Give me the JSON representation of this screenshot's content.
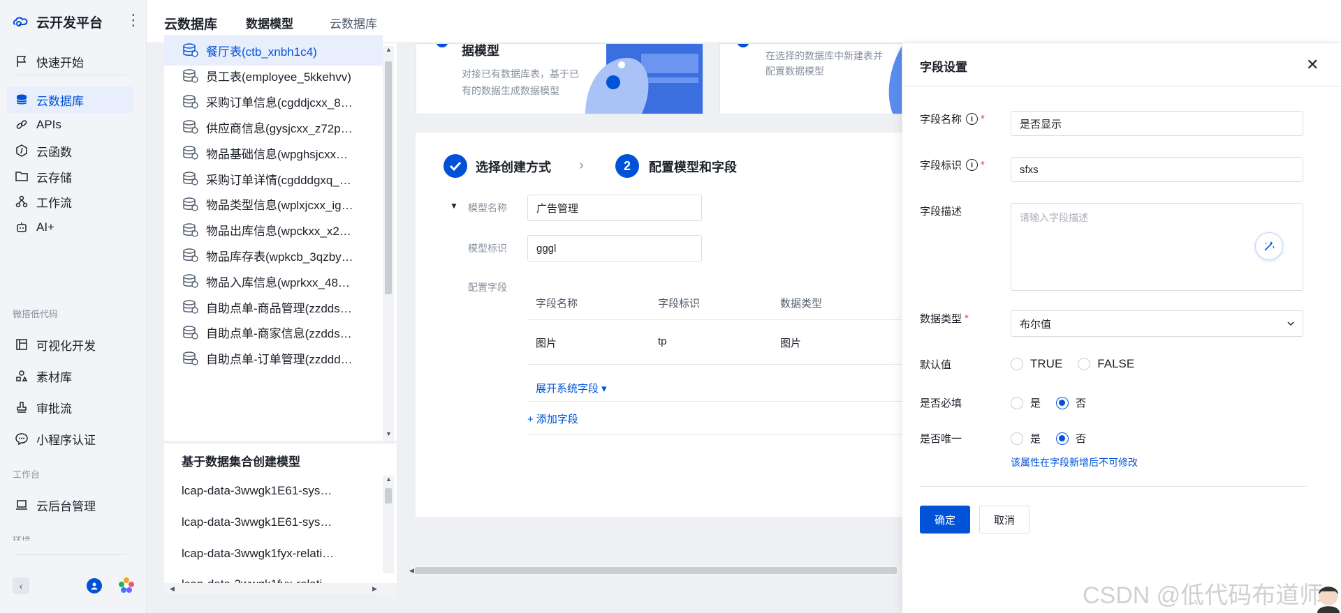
{
  "app": {
    "name": "云开发平台"
  },
  "nav": {
    "items_top": [
      {
        "label": "快速开始",
        "icon": "flag-icon"
      }
    ],
    "items_main": [
      {
        "label": "云数据库",
        "icon": "database-icon",
        "active": true
      },
      {
        "label": "APIs",
        "icon": "link-icon"
      },
      {
        "label": "云函数",
        "icon": "function-icon"
      },
      {
        "label": "云存储",
        "icon": "folder-icon"
      },
      {
        "label": "工作流",
        "icon": "workflow-icon"
      },
      {
        "label": "AI+",
        "icon": "robot-icon"
      }
    ],
    "group_lowcode": "微搭低代码",
    "items_lowcode": [
      {
        "label": "可视化开发",
        "icon": "layout-icon"
      },
      {
        "label": "素材库",
        "icon": "shapes-icon"
      },
      {
        "label": "审批流",
        "icon": "stamp-icon"
      },
      {
        "label": "小程序认证",
        "icon": "chat-icon"
      }
    ],
    "group_workspace": "工作台",
    "items_workspace": [
      {
        "label": "云后台管理",
        "icon": "laptop-icon"
      }
    ],
    "group_env": "环境"
  },
  "topbar": {
    "title": "云数据库",
    "tabs": [
      "数据模型",
      "云数据库"
    ]
  },
  "tables": [
    "餐厅表(ctb_xnbh1c4)",
    "员工表(employee_5kkehvv)",
    "采购订单信息(cgddjcxx_8…",
    "供应商信息(gysjcxx_z72p…",
    "物品基础信息(wpghsjcxx…",
    "采购订单详情(cgdddgxq_…",
    "物品类型信息(wplxjcxx_ig…",
    "物品出库信息(wpckxx_x2…",
    "物品库存表(wpkcb_3qzby…",
    "物品入库信息(wprkxx_48…",
    "自助点单-商品管理(zzdds…",
    "自助点单-商家信息(zzdds…",
    "自助点单-订单管理(zzddd…"
  ],
  "dataset_section": {
    "title": "基于数据集合创建模型",
    "items": [
      "lcap-data-3wwgk1E61-sys…",
      "lcap-data-3wwgk1E61-sys…",
      "lcap-data-3wwgk1fyx-relati…",
      "lcap-data-3wwgk1fyx-relati…"
    ]
  },
  "cards": {
    "existing": {
      "title": "据模型",
      "desc_line1": "对接已有数据库表，基于已",
      "desc_line2": "有的数据生成数据模型"
    },
    "new": {
      "desc_line1": "在选择的数据库中新建表并",
      "desc_line2": "配置数据模型"
    }
  },
  "wizard": {
    "step1": "选择创建方式",
    "step2_num": "2",
    "step2": "配置模型和字段",
    "model_name_label": "模型名称",
    "model_name_value": "广告管理",
    "model_id_label": "模型标识",
    "model_id_value": "gggl",
    "fields_label": "配置字段",
    "table_headers": [
      "字段名称",
      "字段标识",
      "数据类型"
    ],
    "rows": [
      {
        "name": "图片",
        "id": "tp",
        "type": "图片"
      }
    ],
    "expand_system": "展开系统字段 ▾",
    "add_field": "+ 添加字段"
  },
  "drawer": {
    "title": "字段设置",
    "field_name_label": "字段名称",
    "field_name_value": "是否显示",
    "field_id_label": "字段标识",
    "field_id_value": "sfxs",
    "field_desc_label": "字段描述",
    "field_desc_placeholder": "请输入字段描述",
    "data_type_label": "数据类型",
    "data_type_value": "布尔值",
    "default_label": "默认值",
    "default_true": "TRUE",
    "default_false": "FALSE",
    "required_label": "是否必填",
    "unique_label": "是否唯一",
    "yes": "是",
    "no": "否",
    "hint": "该属性在字段新增后不可修改",
    "confirm": "确定",
    "cancel": "取消"
  },
  "watermark": "CSDN @低代码布道师",
  "colors": {
    "primary": "#0052d9",
    "required": "#d54941"
  }
}
